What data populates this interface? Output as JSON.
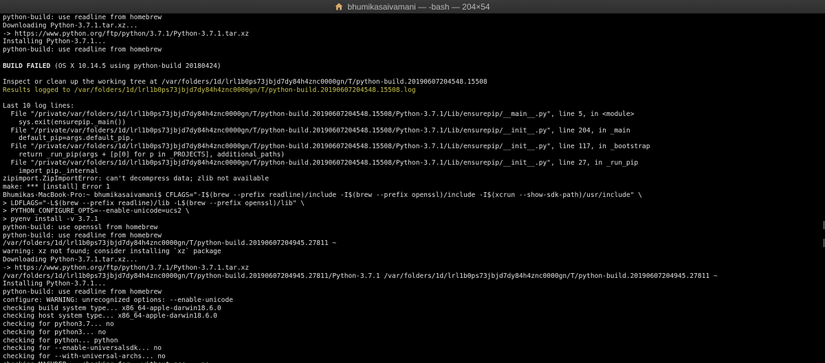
{
  "window": {
    "title": "bhumikasaivamani — -bash — 204×54",
    "icon": "home-folder-icon"
  },
  "colors": {
    "background": "#000000",
    "text": "#e2e2e2",
    "highlight": "#c9c44a"
  },
  "terminal": {
    "lines": [
      {
        "text": "python-build: use readline from homebrew",
        "style": ""
      },
      {
        "text": "Downloading Python-3.7.1.tar.xz...",
        "style": ""
      },
      {
        "text": "-> https://www.python.org/ftp/python/3.7.1/Python-3.7.1.tar.xz",
        "style": ""
      },
      {
        "text": "Installing Python-3.7.1...",
        "style": ""
      },
      {
        "text": "python-build: use readline from homebrew",
        "style": ""
      },
      {
        "text": "",
        "style": ""
      },
      {
        "text": "BUILD FAILED (OS X 10.14.5 using python-build 20180424)",
        "style": "bold-prefix",
        "bold": "BUILD FAILED",
        "rest": " (OS X 10.14.5 using python-build 20180424)"
      },
      {
        "text": "",
        "style": ""
      },
      {
        "text": "Inspect or clean up the working tree at /var/folders/1d/lrl1b0ps73jbjd7dy84h4znc0000gn/T/python-build.20190607204548.15508",
        "style": ""
      },
      {
        "text": "Results logged to /var/folders/1d/lrl1b0ps73jbjd7dy84h4znc0000gn/T/python-build.20190607204548.15508.log",
        "style": "yellow"
      },
      {
        "text": "",
        "style": ""
      },
      {
        "text": "Last 10 log lines:",
        "style": ""
      },
      {
        "text": "  File \"/private/var/folders/1d/lrl1b0ps73jbjd7dy84h4znc0000gn/T/python-build.20190607204548.15508/Python-3.7.1/Lib/ensurepip/__main__.py\", line 5, in <module>",
        "style": ""
      },
      {
        "text": "    sys.exit(ensurepip._main())",
        "style": ""
      },
      {
        "text": "  File \"/private/var/folders/1d/lrl1b0ps73jbjd7dy84h4znc0000gn/T/python-build.20190607204548.15508/Python-3.7.1/Lib/ensurepip/__init__.py\", line 204, in _main",
        "style": ""
      },
      {
        "text": "    default_pip=args.default_pip,",
        "style": ""
      },
      {
        "text": "  File \"/private/var/folders/1d/lrl1b0ps73jbjd7dy84h4znc0000gn/T/python-build.20190607204548.15508/Python-3.7.1/Lib/ensurepip/__init__.py\", line 117, in _bootstrap",
        "style": ""
      },
      {
        "text": "    return _run_pip(args + [p[0] for p in _PROJECTS], additional_paths)",
        "style": ""
      },
      {
        "text": "  File \"/private/var/folders/1d/lrl1b0ps73jbjd7dy84h4znc0000gn/T/python-build.20190607204548.15508/Python-3.7.1/Lib/ensurepip/__init__.py\", line 27, in _run_pip",
        "style": ""
      },
      {
        "text": "    import pip._internal",
        "style": ""
      },
      {
        "text": "zipimport.ZipImportError: can't decompress data; zlib not available",
        "style": ""
      },
      {
        "text": "make: *** [install] Error 1",
        "style": ""
      },
      {
        "text": "Bhumikas-MacBook-Pro:~ bhumikasaivamani$ CFLAGS=\"-I$(brew --prefix readline)/include -I$(brew --prefix openssl)/include -I$(xcrun --show-sdk-path)/usr/include\" \\",
        "style": ""
      },
      {
        "text": "> LDFLAGS=\"-L$(brew --prefix readline)/lib -L$(brew --prefix openssl)/lib\" \\",
        "style": ""
      },
      {
        "text": "> PYTHON_CONFIGURE_OPTS=--enable-unicode=ucs2 \\",
        "style": ""
      },
      {
        "text": "> pyenv install -v 3.7.1",
        "style": ""
      },
      {
        "text": "python-build: use openssl from homebrew",
        "style": ""
      },
      {
        "text": "python-build: use readline from homebrew",
        "style": ""
      },
      {
        "text": "/var/folders/1d/lrl1b0ps73jbjd7dy84h4znc0000gn/T/python-build.20190607204945.27811 ~",
        "style": ""
      },
      {
        "text": "warning: xz not found; consider installing `xz` package",
        "style": ""
      },
      {
        "text": "Downloading Python-3.7.1.tar.xz...",
        "style": ""
      },
      {
        "text": "-> https://www.python.org/ftp/python/3.7.1/Python-3.7.1.tar.xz",
        "style": ""
      },
      {
        "text": "/var/folders/1d/lrl1b0ps73jbjd7dy84h4znc0000gn/T/python-build.20190607204945.27811/Python-3.7.1 /var/folders/1d/lrl1b0ps73jbjd7dy84h4znc0000gn/T/python-build.20190607204945.27811 ~",
        "style": ""
      },
      {
        "text": "Installing Python-3.7.1...",
        "style": ""
      },
      {
        "text": "python-build: use readline from homebrew",
        "style": ""
      },
      {
        "text": "configure: WARNING: unrecognized options: --enable-unicode",
        "style": ""
      },
      {
        "text": "checking build system type... x86_64-apple-darwin18.6.0",
        "style": ""
      },
      {
        "text": "checking host system type... x86_64-apple-darwin18.6.0",
        "style": ""
      },
      {
        "text": "checking for python3.7... no",
        "style": ""
      },
      {
        "text": "checking for python3... no",
        "style": ""
      },
      {
        "text": "checking for python... python",
        "style": ""
      },
      {
        "text": "checking for --enable-universalsdk... no",
        "style": ""
      },
      {
        "text": "checking for --with-universal-archs... no",
        "style": ""
      },
      {
        "text": "checking MACHDEP... checking for --without-gcc... no",
        "style": ""
      }
    ]
  }
}
